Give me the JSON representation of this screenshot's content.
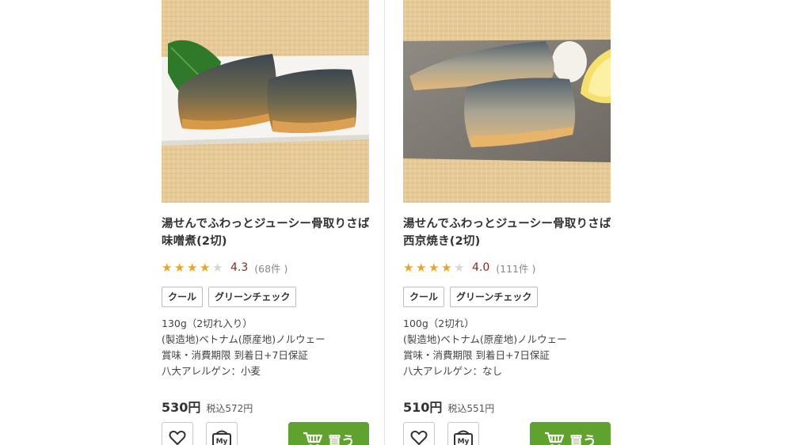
{
  "products": [
    {
      "title_line1": "湯せんでふわっとジューシー骨取りさば",
      "title_line2": "味噌煮(2切)",
      "rating": 4.3,
      "rating_text": "4.3",
      "reviews_text": "(68件 )",
      "tags": [
        "クール",
        "グリーンチェック"
      ],
      "specs": [
        "130g（2切れ入り）",
        "(製造地)ベトナム(原産地)ノルウェー",
        "賞味・消費期限 到着日+7日保証",
        "八大アレルゲン：小麦"
      ],
      "price": "530円",
      "tax_price": "税込572円",
      "buy_label": "買う",
      "favorite_icon": "heart-outline",
      "my_icon_label": "My"
    },
    {
      "title_line1": "湯せんでふわっとジューシー骨取りさば",
      "title_line2": "西京焼き(2切)",
      "rating": 4.0,
      "rating_text": "4.0",
      "reviews_text": "(111件 )",
      "tags": [
        "クール",
        "グリーンチェック"
      ],
      "specs": [
        "100g（2切れ）",
        "(製造地)ベトナム(原産地)ノルウェー",
        "賞味・消費期限 到着日+7日保証",
        "八大アレルゲン：なし"
      ],
      "price": "510円",
      "tax_price": "税込551円",
      "buy_label": "買う",
      "favorite_icon": "heart-outline",
      "my_icon_label": "My"
    }
  ],
  "colors": {
    "star_on": "#f0a41e",
    "star_off": "#d6d6d6",
    "score": "#8a2b14",
    "buy_button": "#5fa22e"
  }
}
